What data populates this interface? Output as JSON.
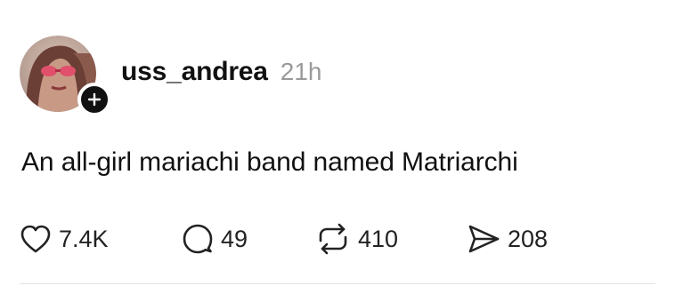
{
  "post": {
    "username": "uss_andrea",
    "timestamp": "21h",
    "text": "An all-girl mariachi band named Matriarchi",
    "actions": {
      "like_count": "7.4K",
      "reply_count": "49",
      "repost_count": "410",
      "share_count": "208"
    }
  },
  "icons": {
    "follow": "plus-icon",
    "like": "heart-icon",
    "reply": "speech-bubble-icon",
    "repost": "repost-arrows-icon",
    "share": "send-icon"
  },
  "colors": {
    "text": "#111111",
    "timestamp": "#9a9a9a",
    "icon": "#222222"
  }
}
